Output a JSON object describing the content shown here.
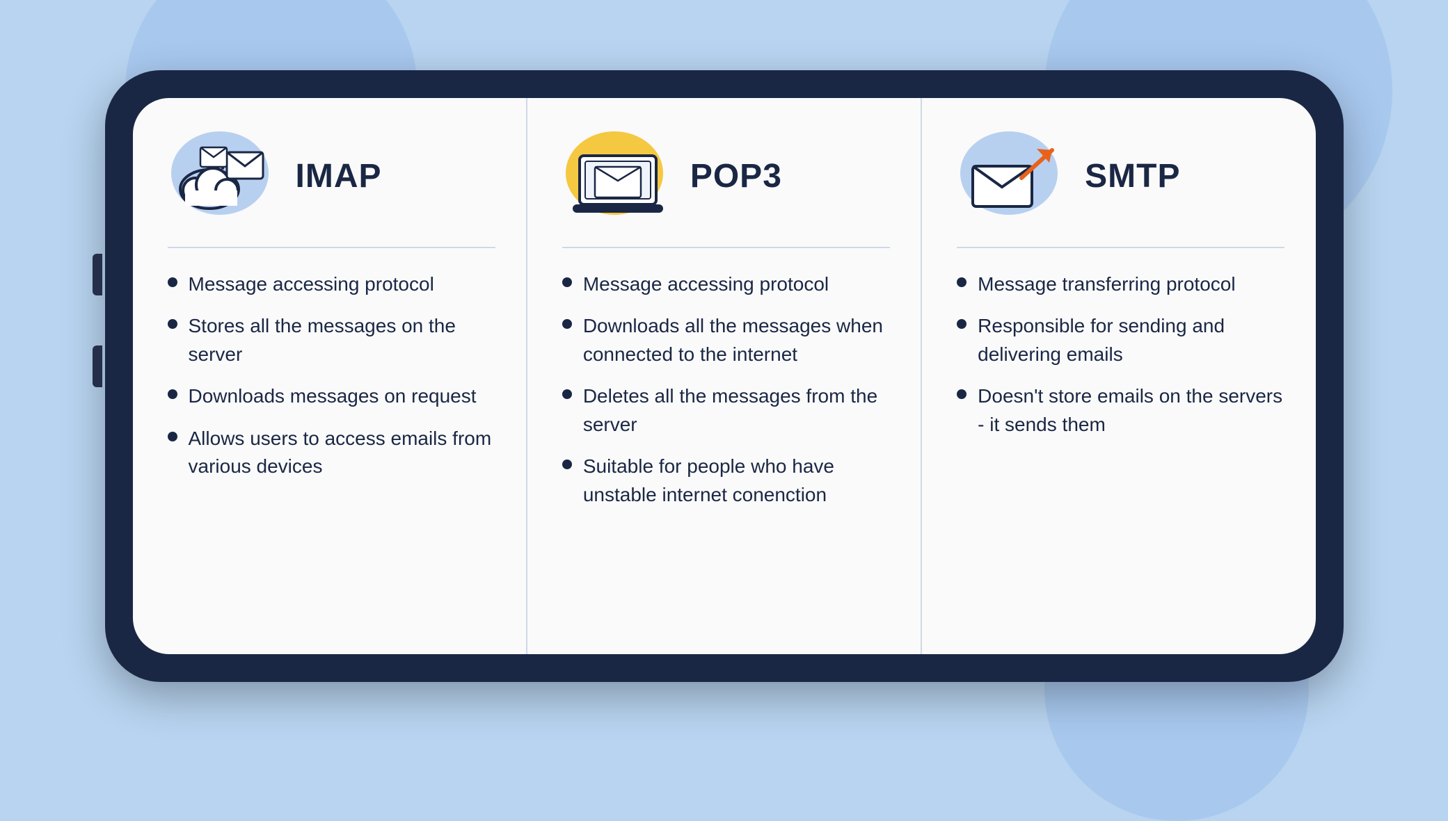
{
  "background": {
    "color": "#b8d4f0"
  },
  "columns": [
    {
      "id": "imap",
      "title": "IMAP",
      "icon_type": "imap",
      "bullet_points": [
        "Message accessing protocol",
        "Stores all the messages on the server",
        "Downloads messages on request",
        "Allows users to access emails from various devices"
      ]
    },
    {
      "id": "pop3",
      "title": "POP3",
      "icon_type": "pop3",
      "bullet_points": [
        "Message accessing protocol",
        "Downloads all the messages when connected to the internet",
        "Deletes all the messages from the server",
        "Suitable for people who have unstable internet conenction"
      ]
    },
    {
      "id": "smtp",
      "title": "SMTP",
      "icon_type": "smtp",
      "bullet_points": [
        "Message transferring protocol",
        "Responsible for sending and delivering emails",
        "Doesn't store emails on the servers - it sends them"
      ]
    }
  ]
}
